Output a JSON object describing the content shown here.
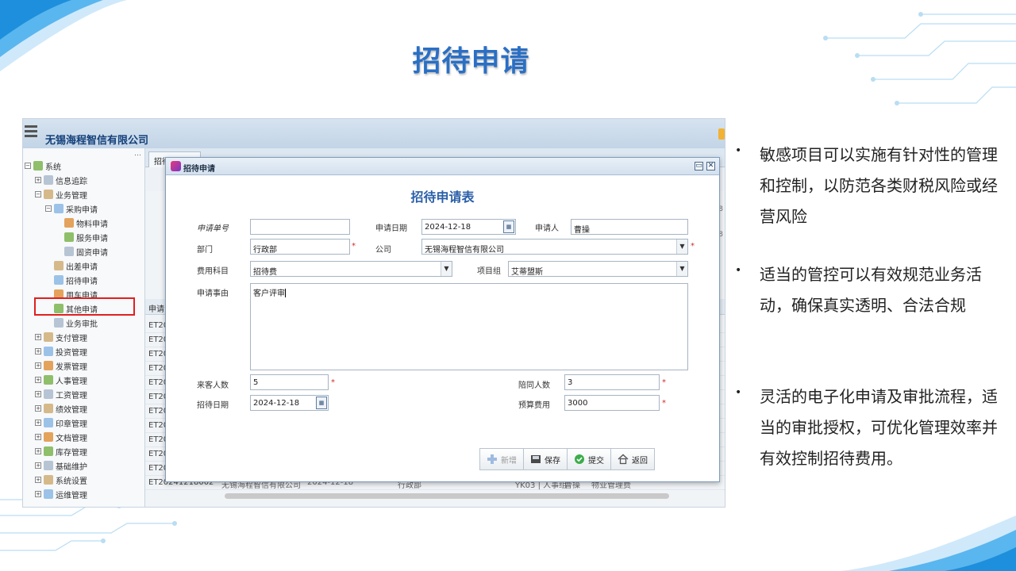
{
  "slide": {
    "title": "招待申请",
    "bullets": [
      "敏感项目可以实施有针对性的管理和控制，以防范各类财税风险或经营风险",
      "适当的管控可以有效规范业务活动，确保真实透明、合法合规",
      "灵活的电子化申请及审批流程，适当的审批授权，可优化管理效率并有效控制招待费用。"
    ]
  },
  "app": {
    "company": "无锡海程智信有限公司",
    "sidebar_more": "…",
    "tree": [
      {
        "label": "系统",
        "level": 0,
        "toggle": "⊟"
      },
      {
        "label": "信息追踪",
        "level": 1,
        "toggle": "⊞"
      },
      {
        "label": "业务管理",
        "level": 1,
        "toggle": "⊟"
      },
      {
        "label": "采购申请",
        "level": 2,
        "toggle": "⊟"
      },
      {
        "label": "物料申请",
        "level": 3,
        "toggle": ""
      },
      {
        "label": "服务申请",
        "level": 3,
        "toggle": ""
      },
      {
        "label": "固资申请",
        "level": 3,
        "toggle": ""
      },
      {
        "label": "出差申请",
        "level": 2,
        "toggle": ""
      },
      {
        "label": "招待申请",
        "level": 2,
        "toggle": ""
      },
      {
        "label": "用车申请",
        "level": 2,
        "toggle": ""
      },
      {
        "label": "其他申请",
        "level": 2,
        "toggle": ""
      },
      {
        "label": "业务审批",
        "level": 2,
        "toggle": ""
      },
      {
        "label": "支付管理",
        "level": 1,
        "toggle": "⊞"
      },
      {
        "label": "投资管理",
        "level": 1,
        "toggle": "⊞"
      },
      {
        "label": "发票管理",
        "level": 1,
        "toggle": "⊞"
      },
      {
        "label": "人事管理",
        "level": 1,
        "toggle": "⊞"
      },
      {
        "label": "工资管理",
        "level": 1,
        "toggle": "⊞"
      },
      {
        "label": "绩效管理",
        "level": 1,
        "toggle": "⊞"
      },
      {
        "label": "印章管理",
        "level": 1,
        "toggle": "⊞"
      },
      {
        "label": "文档管理",
        "level": 1,
        "toggle": "⊞"
      },
      {
        "label": "库存管理",
        "level": 1,
        "toggle": "⊞"
      },
      {
        "label": "基础维护",
        "level": 1,
        "toggle": "⊞"
      },
      {
        "label": "系统设置",
        "level": 1,
        "toggle": "⊞"
      },
      {
        "label": "运维管理",
        "level": 1,
        "toggle": "⊞"
      }
    ],
    "tab_label": "招待申请",
    "tab_close": "×",
    "grid_header": "申请",
    "grid_row_prefix": "ET20",
    "grid_last_row": {
      "code": "ET20241218002",
      "company": "无锡海程智信有限公司",
      "date": "2024-12-18",
      "dept": "行政部",
      "group": "YK03 | 人事组",
      "person": "曹操",
      "note": "物业管理费"
    },
    "right_nums": [
      "18",
      "18"
    ]
  },
  "dialog": {
    "title": "招待申请",
    "heading": "招待申请表",
    "fields": {
      "app_no": {
        "label": "申请单号",
        "value": ""
      },
      "app_date": {
        "label": "申请日期",
        "value": "2024-12-18"
      },
      "applicant": {
        "label": "申请人",
        "value": "曹操"
      },
      "dept": {
        "label": "部门",
        "value": "行政部"
      },
      "company": {
        "label": "公司",
        "value": "无锡海程智信有限公司"
      },
      "expense": {
        "label": "费用科目",
        "value": "招待费"
      },
      "project_group": {
        "label": "项目组",
        "value": "艾蒂盟斯"
      },
      "reason": {
        "label": "申请事由",
        "value": "客户评审"
      },
      "guests": {
        "label": "来客人数",
        "value": "5"
      },
      "companions": {
        "label": "陪同人数",
        "value": "3"
      },
      "host_date": {
        "label": "招待日期",
        "value": "2024-12-18"
      },
      "budget": {
        "label": "预算费用",
        "value": "3000"
      }
    },
    "required_mark": "*",
    "buttons": {
      "new": "新增",
      "save": "保存",
      "submit": "提交",
      "back": "返回"
    }
  },
  "colors": {
    "title_blue": "#2a6fc4",
    "highlight_red": "#e02020",
    "heading_blue": "#2a5fa8"
  }
}
